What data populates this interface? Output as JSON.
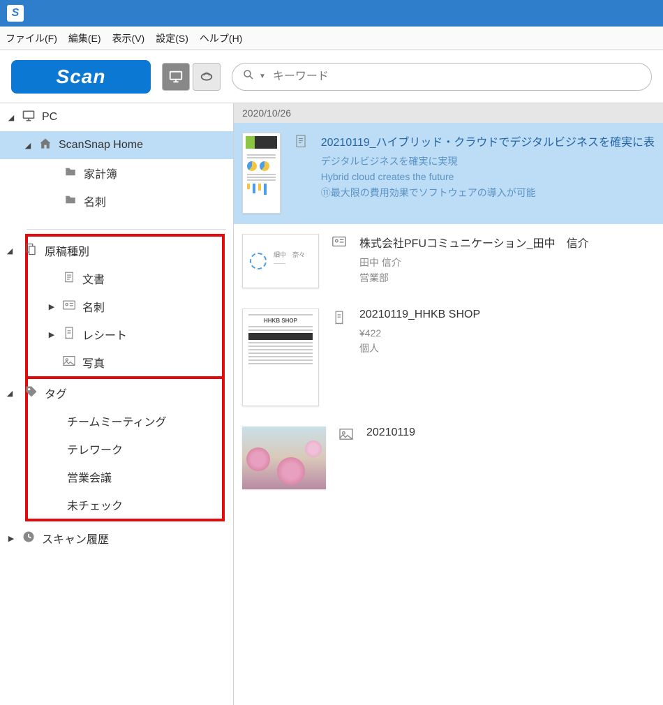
{
  "menus": {
    "file": "ファイル(F)",
    "edit": "編集(E)",
    "view": "表示(V)",
    "settings": "設定(S)",
    "help": "ヘルプ(H)"
  },
  "toolbar": {
    "scan_label": "Scan",
    "search_placeholder": "キーワード"
  },
  "tree": {
    "pc": "PC",
    "scansnap_home": "ScanSnap Home",
    "folder1": "家計簿",
    "folder2": "名刺",
    "doc_type": "原稿種別",
    "type_doc": "文書",
    "type_card": "名刺",
    "type_receipt": "レシート",
    "type_photo": "写真",
    "tag": "タグ",
    "tag1": "チームミーティング",
    "tag2": "テレワーク",
    "tag3": "営業会議",
    "tag4": "未チェック",
    "scan_history": "スキャン履歴"
  },
  "list": {
    "date_header": "2020/10/26",
    "item1": {
      "title": "20210119_ハイブリッド・クラウドでデジタルビジネスを確実に表",
      "sub1": "デジタルビジネスを確実に実現",
      "sub2": "Hybrid cloud creates the future",
      "sub3": "⑪最大限の費用効果でソフトウェアの導入が可能"
    },
    "item2": {
      "title": "株式会社PFUコミュニケーション_田中　信介",
      "sub1": "田中 信介",
      "sub2": "営業部"
    },
    "item3": {
      "title": "20210119_HHKB SHOP",
      "sub1": "¥422",
      "sub2": "個人",
      "receipt_store": "HHKB SHOP"
    },
    "item4": {
      "title": "20210119"
    }
  }
}
